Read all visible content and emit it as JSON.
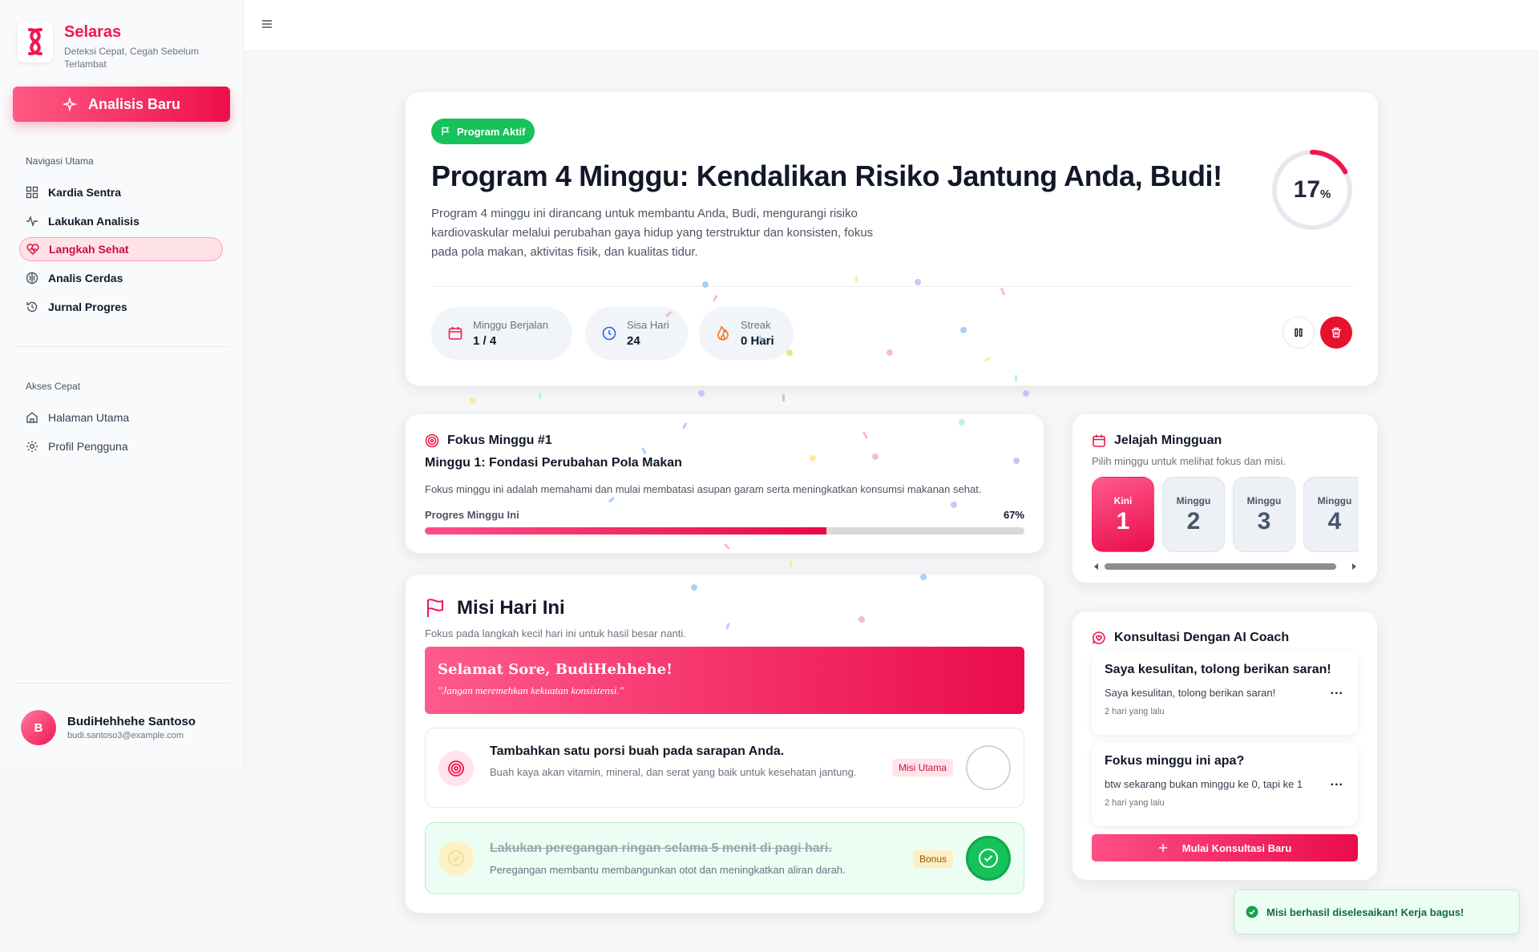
{
  "brand": {
    "name": "Selaras",
    "tagline": "Deteksi Cepat, Cegah Sebelum Terlambat"
  },
  "sidebar": {
    "new_analysis": "Analisis Baru",
    "nav_heading": "Navigasi Utama",
    "nav": [
      {
        "label": "Kardia Sentra",
        "icon": "dashboard-icon"
      },
      {
        "label": "Lakukan Analisis",
        "icon": "pulse-icon"
      },
      {
        "label": "Langkah Sehat",
        "icon": "heart-icon",
        "active": true
      },
      {
        "label": "Analis Cerdas",
        "icon": "brain-icon"
      },
      {
        "label": "Jurnal Progres",
        "icon": "history-icon"
      }
    ],
    "quick_heading": "Akses Cepat",
    "quick": [
      {
        "label": "Halaman Utama",
        "icon": "home-icon"
      },
      {
        "label": "Profil Pengguna",
        "icon": "gear-icon"
      }
    ],
    "user": {
      "initial": "B",
      "name": "BudiHehhehe Santoso",
      "email": "budi.santoso3@example.com"
    }
  },
  "hero": {
    "badge": "Program Aktif",
    "title": "Program 4 Minggu: Kendalikan Risiko Jantung Anda, Budi!",
    "description": "Program 4 minggu ini dirancang untuk membantu Anda, Budi, mengurangi risiko kardiovaskular melalui perubahan gaya hidup yang terstruktur dan konsisten, fokus pada pola makan, aktivitas fisik, dan kualitas tidur.",
    "progress_value": "17",
    "progress_unit": "%",
    "progress_fraction": 0.17,
    "stats": [
      {
        "label": "Minggu Berjalan",
        "value": "1 / 4",
        "icon": "calendar-icon"
      },
      {
        "label": "Sisa Hari",
        "value": "24",
        "icon": "clock-icon"
      },
      {
        "label": "Streak",
        "value": "0 Hari",
        "icon": "flame-icon"
      }
    ]
  },
  "focus": {
    "title": "Fokus Minggu #1",
    "subtitle": "Minggu 1: Fondasi Perubahan Pola Makan",
    "description": "Fokus minggu ini adalah memahami dan mulai membatasi asupan garam serta meningkatkan konsumsi makanan sehat.",
    "progress_label": "Progres Minggu Ini",
    "progress_text": "67%",
    "progress_fraction": 0.67
  },
  "missions": {
    "title": "Misi Hari Ini",
    "subtitle": "Fokus pada langkah kecil hari ini untuk hasil besar nanti.",
    "greeting": "Selamat Sore, BudiHehhehe!",
    "quote": "\"Jangan meremehkan kekuatan konsistensi.\"",
    "items": [
      {
        "title": "Tambahkan satu porsi buah pada sarapan Anda.",
        "desc": "Buah kaya akan vitamin, mineral, dan serat yang baik untuk kesehatan jantung.",
        "tag": "Misi Utama",
        "done": false
      },
      {
        "title": "Lakukan peregangan ringan selama 5 menit di pagi hari.",
        "desc": "Peregangan membantu membangunkan otot dan meningkatkan aliran darah.",
        "tag": "Bonus",
        "done": true
      }
    ]
  },
  "weeks": {
    "title": "Jelajah Mingguan",
    "subtitle": "Pilih minggu untuk melihat fokus dan misi.",
    "items": [
      {
        "label": "Kini",
        "number": "1",
        "current": true
      },
      {
        "label": "Minggu",
        "number": "2"
      },
      {
        "label": "Minggu",
        "number": "3"
      },
      {
        "label": "Minggu",
        "number": "4"
      }
    ]
  },
  "coach": {
    "title": "Konsultasi Dengan AI Coach",
    "chats": [
      {
        "title": "Saya kesulitan, tolong berikan saran!",
        "message": "Saya kesulitan, tolong berikan saran!",
        "time": "2 hari yang lalu"
      },
      {
        "title": "Fokus minggu ini apa?",
        "message": "btw sekarang bukan minggu ke 0, tapi ke 1",
        "time": "2 hari yang lalu"
      }
    ],
    "new_button": "Mulai Konsultasi Baru",
    "more": "..."
  },
  "toast": {
    "message": "Misi berhasil diselesaikan! Kerja bagus!"
  },
  "colors": {
    "accent": "#f0174e",
    "success": "#16c25b",
    "danger": "#e8112d"
  }
}
